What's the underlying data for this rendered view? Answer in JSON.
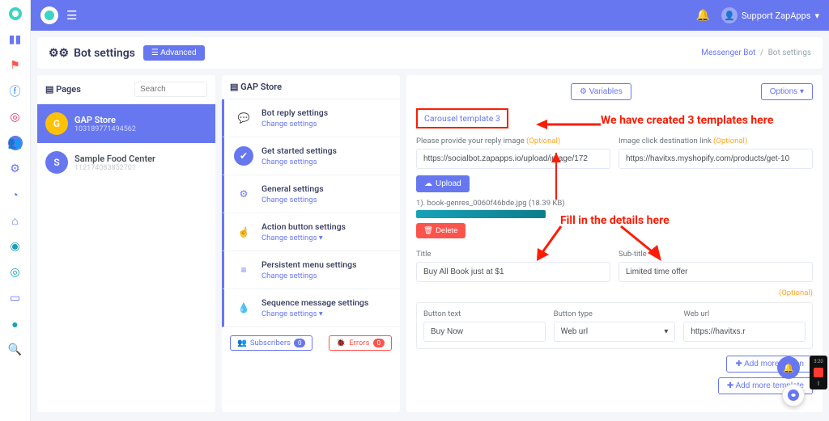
{
  "topbar": {
    "user": "Support ZapApps"
  },
  "header": {
    "title": "Bot settings",
    "advanced": "Advanced",
    "bc1": "Messenger Bot",
    "bc2": "Bot settings"
  },
  "pages": {
    "head": "Pages",
    "search_ph": "Search",
    "items": [
      {
        "letter": "G",
        "title": "GAP Store",
        "sub": "103189771494562",
        "color": "#ffc107"
      },
      {
        "letter": "S",
        "title": "Sample Food Center",
        "sub": "112174083852701",
        "color": "#6777ef"
      }
    ]
  },
  "gap": {
    "head": "GAP Store",
    "items": [
      {
        "title": "Bot reply settings",
        "link": "Change settings"
      },
      {
        "title": "Get started settings",
        "link": "Change settings"
      },
      {
        "title": "General settings",
        "link": "Change settings"
      },
      {
        "title": "Action button settings",
        "link": "Change settings"
      },
      {
        "title": "Persistent menu settings",
        "link": "Change settings"
      },
      {
        "title": "Sequence message settings",
        "link": "Change settings"
      }
    ],
    "subs": "Subscribers",
    "subs_n": "0",
    "errs": "Errors",
    "errs_n": "0"
  },
  "main": {
    "variables": "Variables",
    "options": "Options",
    "tab": "Carousel template 3",
    "annot1": "We have created 3 templates here",
    "annot2": "Fill in the details here",
    "l_img": "Please provide your reply image",
    "l_dest": "Image click destination link",
    "opt": "(Optional)",
    "img_val": "https://socialbot.zapapps.io/upload/image/172",
    "dest_val": "https://havitxs.myshopify.com/products/get-10",
    "upload": "Upload",
    "file": "1). book-genres_0060f46bde.jpg (18.39 KB)",
    "delete": "Delete",
    "l_title": "Title",
    "l_sub": "Sub-title",
    "title_val": "Buy All Book just at $1",
    "sub_val": "Limited time offer",
    "l_btntext": "Button text",
    "l_btntype": "Button type",
    "l_weburl": "Web url",
    "btntext_val": "Buy Now",
    "btntype_val": "Web url",
    "weburl_val": "https://havitxs.r",
    "addmorebtn": "Add more button",
    "addmoretpl": "Add more template"
  },
  "rec": {
    "time": "3:20",
    "lbl": "||"
  }
}
